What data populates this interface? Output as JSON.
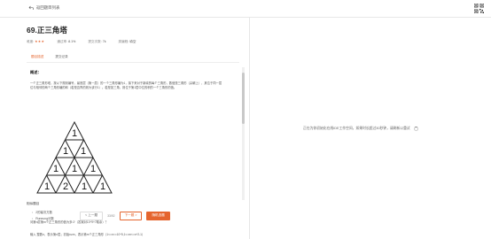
{
  "header": {
    "back_label": "返回题目列表"
  },
  "problem": {
    "title": "69.正三角塔",
    "meta": {
      "difficulty_label": "难度:",
      "difficulty_stars": "★★★",
      "pass_rate_label": "通过率:",
      "pass_rate": "8.1%",
      "submissions_label": "提交次数:",
      "submissions": "7k",
      "type_label": "类编程:",
      "type_value": "填空"
    },
    "tabs": [
      {
        "label": "题目描述",
        "active": true
      },
      {
        "label": "提交记录",
        "active": false
      }
    ],
    "section_title": "概述：",
    "description": "一个正三角形塔，按以下规则编号，最底层（第一层）的一个三角形编为1，接下来对于新增的每个三角形，数值是三角形（尖朝上），其位于同一层位与相邻的两个三角形编的和（若是边界的则为该行1）。若是如三角，则位于第1层中位的积的一个三角形的值。",
    "triangle_rows": [
      [
        "1"
      ],
      [
        "1",
        "1"
      ],
      [
        "1",
        "1",
        "1"
      ],
      [
        "1",
        "2",
        "1"
      ]
    ],
    "question1": "问第n层第m个正三角形的值为多少（答案对10^9+7取余）？",
    "question2": "输入 整数n，表示第n层；初始n≥m，表示第m个正三角形（1<=n<=10^5,1<=m<=n^2-1）"
  },
  "related": {
    "title": "相似题目",
    "items": [
      "2的幂次方数",
      "Runeung分数"
    ]
  },
  "footer": {
    "prev_label": "< 上一题",
    "page_info": "33/92",
    "next_label": "下一题 >",
    "random_label": "随机选题"
  },
  "right_panel": {
    "loading_text": "正在为你初始化在线IDE工作空间，如果时长超过30秒钟，请刷新以重试"
  },
  "colors": {
    "accent": "#e5652e"
  }
}
